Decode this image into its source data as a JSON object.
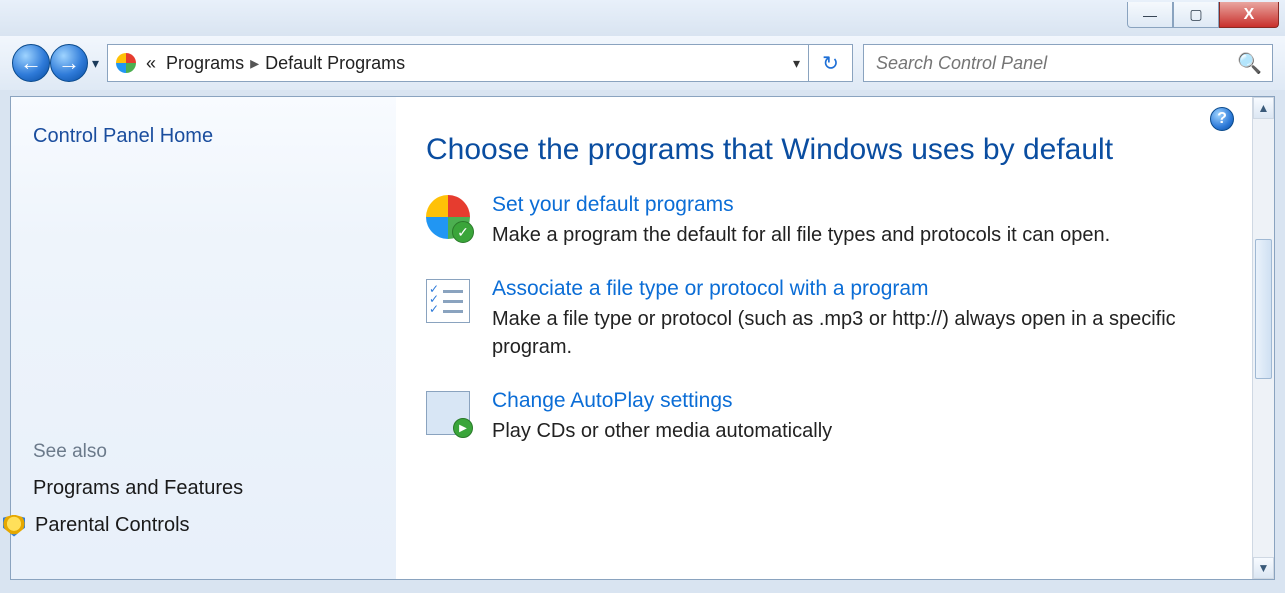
{
  "window": {
    "minimize_glyph": "—",
    "maximize_glyph": "▢",
    "close_glyph": "X"
  },
  "nav": {
    "back_glyph": "←",
    "forward_glyph": "→",
    "history_glyph": "▾"
  },
  "address": {
    "chevrons": "«",
    "crumb1": "Programs",
    "sep": "▸",
    "crumb2": "Default Programs",
    "dropdown_glyph": "▾",
    "refresh_glyph": "↻"
  },
  "search": {
    "placeholder": "Search Control Panel",
    "icon_glyph": "🔍"
  },
  "sidebar": {
    "home": "Control Panel Home",
    "see_also_header": "See also",
    "programs_features": "Programs and Features",
    "parental_controls": "Parental Controls"
  },
  "main": {
    "help_glyph": "?",
    "title": "Choose the programs that Windows uses by default",
    "options": [
      {
        "link": "Set your default programs",
        "desc": "Make a program the default for all file types and protocols it can open."
      },
      {
        "link": "Associate a file type or protocol with a program",
        "desc": "Make a file type or protocol (such as .mp3 or http://) always open in a specific program."
      },
      {
        "link": "Change AutoPlay settings",
        "desc": "Play CDs or other media automatically"
      }
    ]
  },
  "scrollbar": {
    "up_glyph": "▲",
    "down_glyph": "▼"
  }
}
